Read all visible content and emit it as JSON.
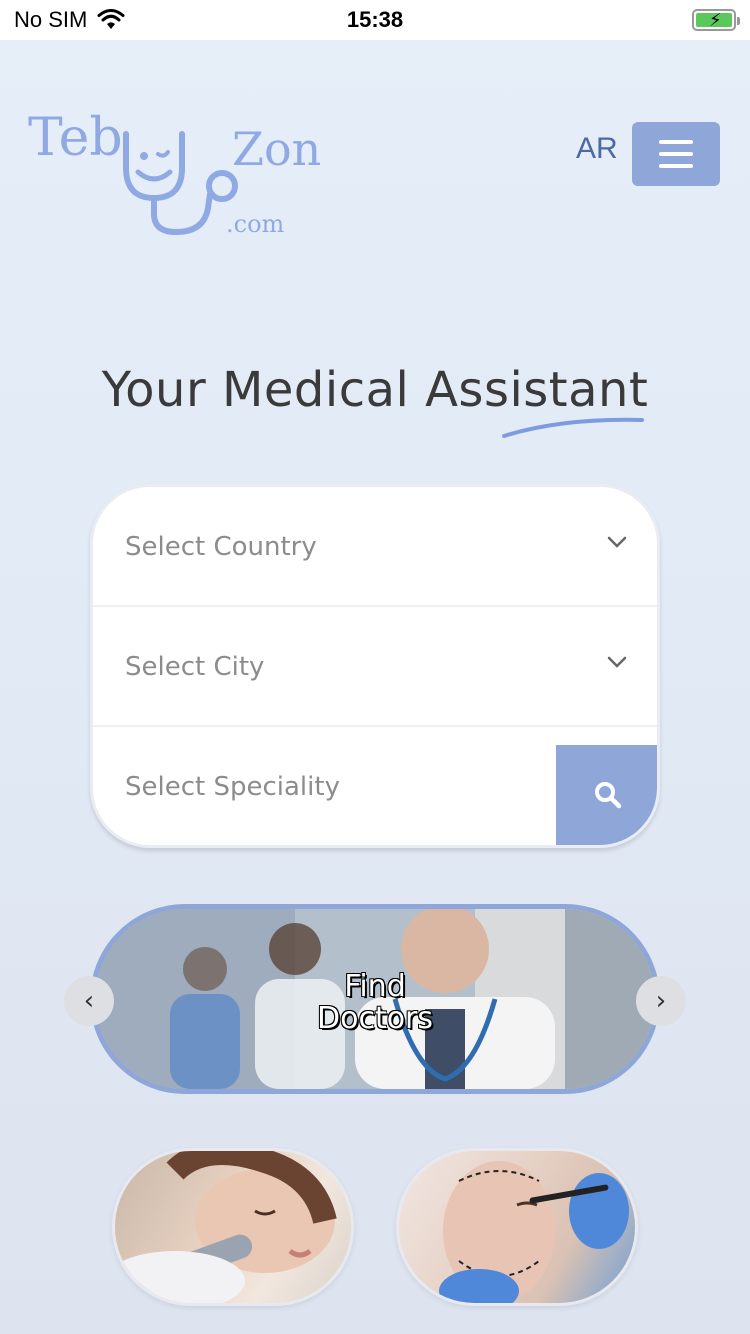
{
  "status_bar": {
    "carrier": "No SIM",
    "time": "15:38",
    "icons": [
      "wifi-icon",
      "battery-charging-icon"
    ]
  },
  "header": {
    "logo": {
      "part1": "Teb",
      "part2": "Zon",
      "domain": ".com"
    },
    "language_toggle": "AR",
    "menu_icon": "hamburger-icon"
  },
  "hero": {
    "title": "Your Medical Assistant"
  },
  "search": {
    "country_placeholder": "Select Country",
    "city_placeholder": "Select City",
    "speciality_placeholder": "Select Speciality",
    "search_icon": "search-icon",
    "dropdown_icon": "chevron-down-icon"
  },
  "carousel": {
    "slide_label_line1": "Find",
    "slide_label_line2": "Doctors",
    "prev_icon": "chevron-left-icon",
    "next_icon": "chevron-right-icon"
  },
  "categories": [
    {
      "icon": "skincare-image"
    },
    {
      "icon": "plastic-surgery-image"
    }
  ],
  "colors": {
    "accent": "#8fa7d8",
    "logo": "#8fa9e3",
    "lang_text": "#4e6aa3"
  }
}
